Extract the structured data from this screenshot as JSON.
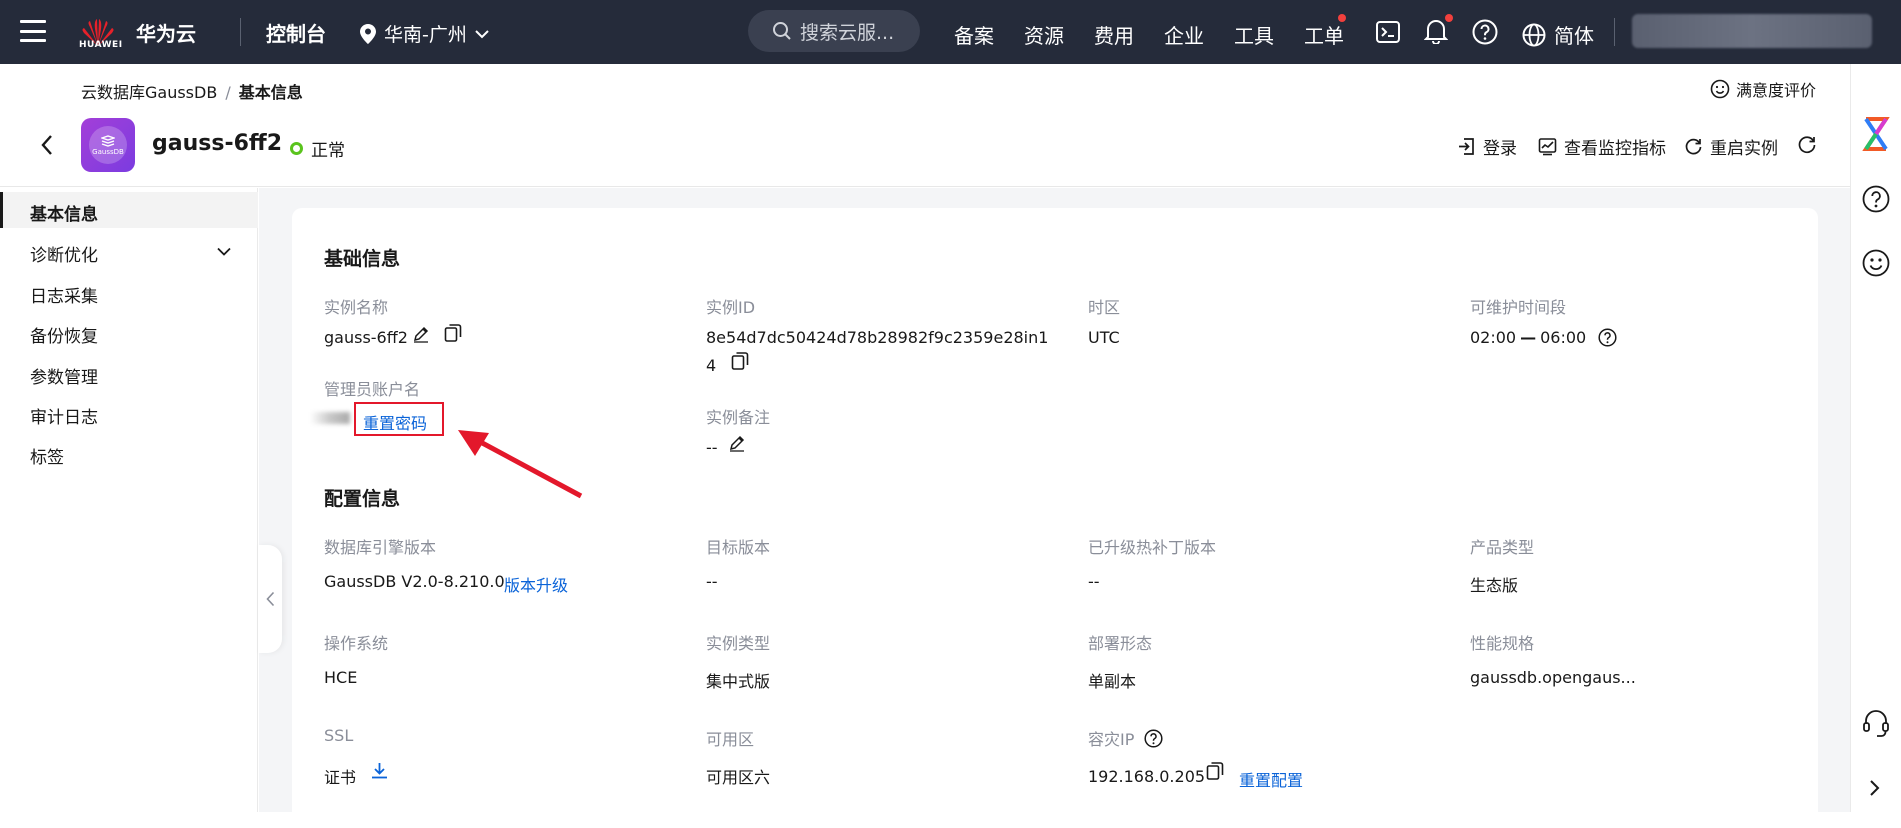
{
  "topnav": {
    "brand_sub": "HUAWEI",
    "brand": "华为云",
    "console": "控制台",
    "region": "华南-广州",
    "search_placeholder": "搜索云服...",
    "links": [
      "备案",
      "资源",
      "费用",
      "企业",
      "工具",
      "工单"
    ],
    "language": "简体",
    "notification_color": "#f2403d"
  },
  "header": {
    "breadcrumb_root": "云数据库GaussDB",
    "breadcrumb_sep": "/",
    "breadcrumb_current": "基本信息",
    "satisfaction": "满意度评价",
    "icon_text": "GaussDB",
    "instance_name": "gauss-6ff2",
    "status": "正常",
    "status_color": "#5ac41d",
    "actions": {
      "login": "登录",
      "monitor": "查看监控指标",
      "restart": "重启实例"
    }
  },
  "sidebar": {
    "items": [
      "基本信息",
      "诊断优化",
      "日志采集",
      "备份恢复",
      "参数管理",
      "审计日志",
      "标签"
    ]
  },
  "basic": {
    "title": "基础信息",
    "instance_name_label": "实例名称",
    "instance_name": "gauss-6ff2",
    "instance_id_label": "实例ID",
    "instance_id_line1": "8e54d7dc50424d78b28982f9c2359e28in1",
    "instance_id_line2": "4",
    "timezone_label": "时区",
    "timezone": "UTC",
    "maintenance_label": "可维护时间段",
    "maintenance_start": "02:00",
    "maintenance_dash": "—",
    "maintenance_end": "06:00",
    "admin_label": "管理员账户名",
    "reset_password": "重置密码",
    "remark_label": "实例备注",
    "remark": "--"
  },
  "config": {
    "title": "配置信息",
    "engine_label": "数据库引擎版本",
    "engine": "GaussDB V2.0-8.210.0",
    "upgrade": "版本升级",
    "target_label": "目标版本",
    "target": "--",
    "patch_label": "已升级热补丁版本",
    "patch": "--",
    "product_label": "产品类型",
    "product": "生态版",
    "os_label": "操作系统",
    "os": "HCE",
    "type_label": "实例类型",
    "type": "集中式版",
    "deploy_label": "部署形态",
    "deploy": "单副本",
    "spec_label": "性能规格",
    "spec": "gaussdb.opengaus...",
    "ssl_label": "SSL",
    "ssl": "证书",
    "az_label": "可用区",
    "az": "可用区六",
    "dr_label": "容灾IP",
    "dr_ip": "192.168.0.205",
    "reset_config": "重置配置"
  },
  "colors": {
    "topbar": "#252b3a",
    "link": "#0a63d8",
    "highlight_box": "#e3182b"
  }
}
